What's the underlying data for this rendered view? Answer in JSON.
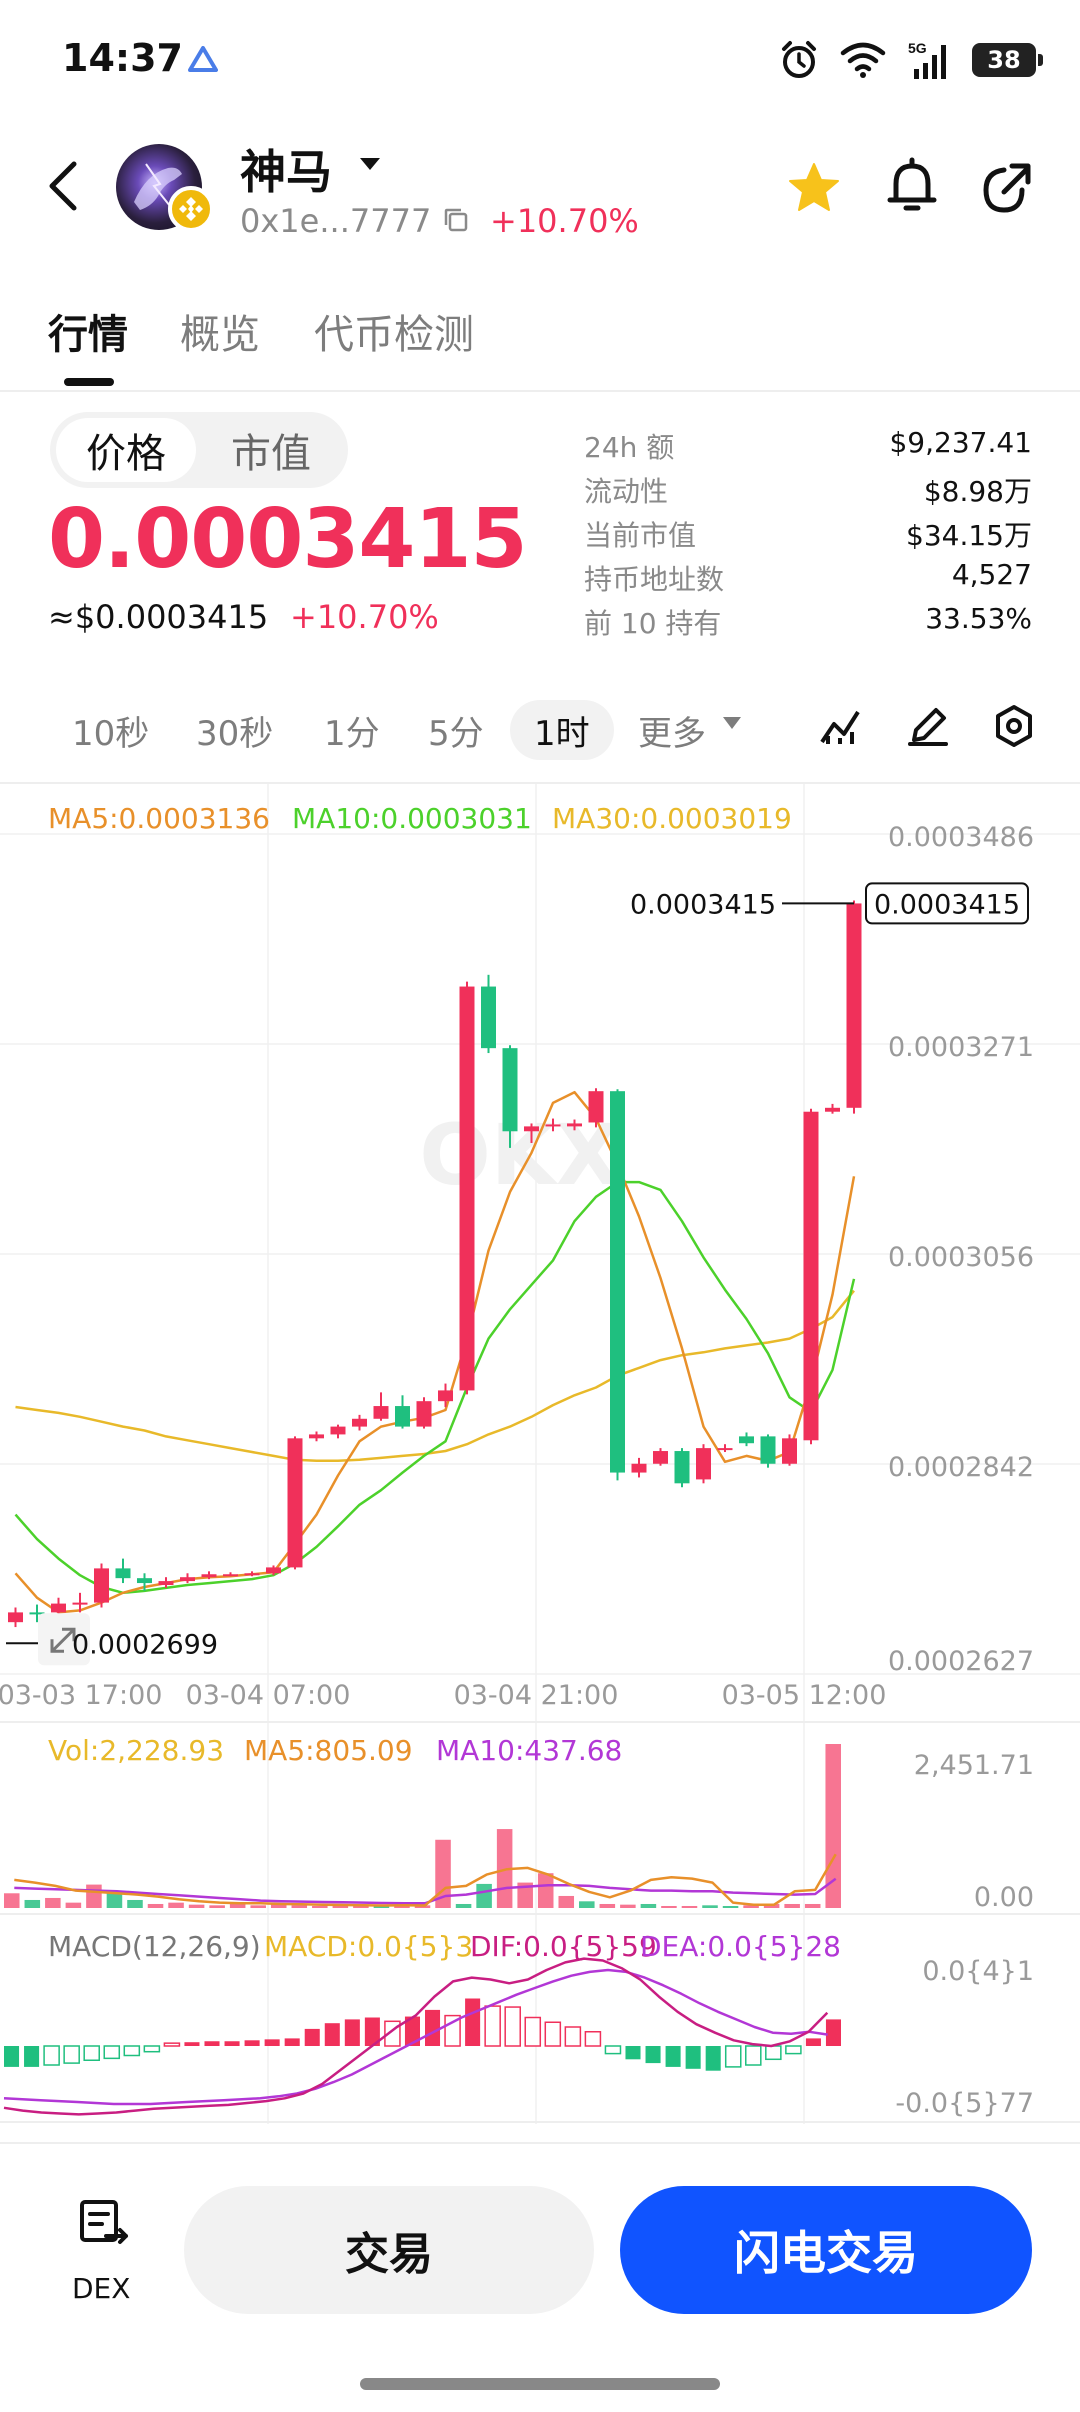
{
  "status_bar": {
    "time": "14:37",
    "battery": "38",
    "network": "5G"
  },
  "header": {
    "token_name": "神马",
    "address": "0x1e...7777",
    "change": "+10.70%"
  },
  "tabs": [
    "行情",
    "概览",
    "代币检测"
  ],
  "price_toggle": {
    "price": "价格",
    "market_cap": "市值"
  },
  "price": {
    "value": "0.0003415",
    "usd": "≈$0.0003415",
    "change": "+10.70%"
  },
  "stats": [
    {
      "label": "24h  额",
      "value": "$9,237.41"
    },
    {
      "label": "流动性",
      "value": "$8.98万"
    },
    {
      "label": "当前市值",
      "value": "$34.15万"
    },
    {
      "label": "持币地址数",
      "value": "4,527"
    },
    {
      "label": "前 10 持有",
      "value": "33.53%"
    }
  ],
  "intervals": [
    "10秒",
    "30秒",
    "1分",
    "5分",
    "1时",
    "更多"
  ],
  "chart_data": {
    "type": "candlestick",
    "indicators": {
      "ma": [
        {
          "name": "MA5",
          "label": "MA5:0.0003136",
          "color": "#e8902a"
        },
        {
          "name": "MA10",
          "label": "MA10:0.0003031",
          "color": "#4cd12b"
        },
        {
          "name": "MA30",
          "label": "MA30:0.0003019",
          "color": "#e8b92a"
        }
      ]
    },
    "y_ticks": [
      "0.0003486",
      "0.0003271",
      "0.0003056",
      "0.0002842",
      "0.0002627"
    ],
    "ylim": [
      0.0002627,
      0.0003486
    ],
    "x_ticks": [
      "03-03 17:00",
      "03-04 07:00",
      "03-04 21:00",
      "03-05 12:00"
    ],
    "current_price_label": "0.0003415",
    "current_price_tag": "0.0003415",
    "low_label": "0.0002699",
    "candles": [
      {
        "o": 0.000268,
        "c": 0.000269,
        "h": 0.0002695,
        "l": 0.0002675
      },
      {
        "o": 0.000269,
        "c": 0.0002688,
        "h": 0.0002698,
        "l": 0.000268
      },
      {
        "o": 0.000269,
        "c": 0.0002699,
        "h": 0.0002705,
        "l": 0.0002685
      },
      {
        "o": 0.0002699,
        "c": 0.00027,
        "h": 0.000271,
        "l": 0.000269
      },
      {
        "o": 0.00027,
        "c": 0.0002735,
        "h": 0.000274,
        "l": 0.0002695
      },
      {
        "o": 0.0002735,
        "c": 0.0002725,
        "h": 0.0002745,
        "l": 0.000272
      },
      {
        "o": 0.0002725,
        "c": 0.000272,
        "h": 0.000273,
        "l": 0.0002712
      },
      {
        "o": 0.0002718,
        "c": 0.0002722,
        "h": 0.0002726,
        "l": 0.0002715
      },
      {
        "o": 0.0002722,
        "c": 0.0002726,
        "h": 0.000273,
        "l": 0.000272
      },
      {
        "o": 0.0002726,
        "c": 0.0002729,
        "h": 0.0002732,
        "l": 0.0002724
      },
      {
        "o": 0.0002729,
        "c": 0.0002729,
        "h": 0.0002731,
        "l": 0.0002727
      },
      {
        "o": 0.0002729,
        "c": 0.000273,
        "h": 0.0002732,
        "l": 0.0002727
      },
      {
        "o": 0.000273,
        "c": 0.0002736,
        "h": 0.0002738,
        "l": 0.0002728
      },
      {
        "o": 0.0002736,
        "c": 0.0002868,
        "h": 0.000287,
        "l": 0.0002734
      },
      {
        "o": 0.0002868,
        "c": 0.0002872,
        "h": 0.0002875,
        "l": 0.0002865
      },
      {
        "o": 0.0002872,
        "c": 0.000288,
        "h": 0.0002882,
        "l": 0.0002868
      },
      {
        "o": 0.000288,
        "c": 0.0002888,
        "h": 0.0002892,
        "l": 0.0002876
      },
      {
        "o": 0.0002888,
        "c": 0.0002901,
        "h": 0.0002915,
        "l": 0.0002886
      },
      {
        "o": 0.0002901,
        "c": 0.000288,
        "h": 0.0002912,
        "l": 0.0002878
      },
      {
        "o": 0.000288,
        "c": 0.0002906,
        "h": 0.000291,
        "l": 0.0002878
      },
      {
        "o": 0.0002906,
        "c": 0.0002917,
        "h": 0.0002924,
        "l": 0.00029
      },
      {
        "o": 0.0002917,
        "c": 0.000333,
        "h": 0.0003335,
        "l": 0.0002913
      },
      {
        "o": 0.000333,
        "c": 0.0003267,
        "h": 0.0003342,
        "l": 0.0003262
      },
      {
        "o": 0.0003267,
        "c": 0.0003182,
        "h": 0.000327,
        "l": 0.0003165
      },
      {
        "o": 0.0003182,
        "c": 0.0003187,
        "h": 0.000319,
        "l": 0.000317
      },
      {
        "o": 0.0003187,
        "c": 0.0003189,
        "h": 0.0003195,
        "l": 0.0003182
      },
      {
        "o": 0.0003187,
        "c": 0.000319,
        "h": 0.0003194,
        "l": 0.0003183
      },
      {
        "o": 0.0003191,
        "c": 0.0003223,
        "h": 0.0003226,
        "l": 0.0003186
      },
      {
        "o": 0.0003223,
        "c": 0.0002833,
        "h": 0.0003225,
        "l": 0.0002825
      },
      {
        "o": 0.0002833,
        "c": 0.0002842,
        "h": 0.0002848,
        "l": 0.0002828
      },
      {
        "o": 0.0002842,
        "c": 0.0002855,
        "h": 0.0002858,
        "l": 0.000284
      },
      {
        "o": 0.0002855,
        "c": 0.0002822,
        "h": 0.0002858,
        "l": 0.0002818
      },
      {
        "o": 0.0002826,
        "c": 0.0002858,
        "h": 0.0002862,
        "l": 0.0002822
      },
      {
        "o": 0.0002858,
        "c": 0.0002858,
        "h": 0.0002862,
        "l": 0.0002854
      },
      {
        "o": 0.000287,
        "c": 0.0002863,
        "h": 0.0002874,
        "l": 0.000286
      },
      {
        "o": 0.000287,
        "c": 0.0002842,
        "h": 0.0002872,
        "l": 0.0002838
      },
      {
        "o": 0.0002842,
        "c": 0.0002868,
        "h": 0.0002872,
        "l": 0.000284
      },
      {
        "o": 0.0002866,
        "c": 0.0003202,
        "h": 0.0003205,
        "l": 0.0002862
      },
      {
        "o": 0.0003202,
        "c": 0.0003206,
        "h": 0.000321,
        "l": 0.00032
      },
      {
        "o": 0.0003206,
        "c": 0.0003415,
        "h": 0.0003418,
        "l": 0.00032
      }
    ],
    "ma5_line": [
      0.000273,
      0.0002705,
      0.000269,
      0.0002692,
      0.00027,
      0.000271,
      0.0002716,
      0.000272,
      0.0002724,
      0.0002726,
      0.0002727,
      0.0002729,
      0.0002731,
      0.000276,
      0.000279,
      0.000283,
      0.0002865,
      0.000288,
      0.0002885,
      0.0002889,
      0.0002897,
      0.000297,
      0.000306,
      0.000312,
      0.000316,
      0.0003211,
      0.0003222,
      0.0003195,
      0.0003148,
      0.0003095,
      0.0003032,
      0.000296,
      0.000288,
      0.0002844,
      0.000285,
      0.0002845,
      0.0002854,
      0.0002925,
      0.0003015,
      0.0003136
    ],
    "ma10_line": [
      0.000279,
      0.0002765,
      0.0002745,
      0.0002728,
      0.0002716,
      0.000271,
      0.0002712,
      0.0002715,
      0.0002718,
      0.000272,
      0.0002722,
      0.0002724,
      0.0002728,
      0.000274,
      0.0002757,
      0.0002778,
      0.00028,
      0.0002815,
      0.0002833,
      0.000285,
      0.0002865,
      0.000292,
      0.000297,
      0.0003,
      0.0003025,
      0.000305,
      0.000309,
      0.0003115,
      0.000313,
      0.000313,
      0.0003122,
      0.000309,
      0.0003053,
      0.000302,
      0.000299,
      0.0002955,
      0.000291,
      0.0002895,
      0.0002938,
      0.0003031
    ],
    "ma30_line": [
      0.00029,
      0.0002897,
      0.0002894,
      0.000289,
      0.0002885,
      0.000288,
      0.0002876,
      0.000287,
      0.0002866,
      0.0002862,
      0.0002858,
      0.0002854,
      0.000285,
      0.0002846,
      0.0002845,
      0.0002845,
      0.0002846,
      0.0002848,
      0.000285,
      0.0002852,
      0.0002855,
      0.0002862,
      0.0002872,
      0.000288,
      0.000289,
      0.0002902,
      0.0002912,
      0.000292,
      0.0002932,
      0.000294,
      0.0002948,
      0.0002953,
      0.0002956,
      0.000296,
      0.0002963,
      0.0002966,
      0.000297,
      0.000298,
      0.0002992,
      0.0003019
    ],
    "volume": {
      "labels": {
        "vol": "Vol:2,228.93",
        "ma5": "MA5:805.09",
        "ma10": "MA10:437.68"
      },
      "y_ticks": [
        "2,451.71",
        "0.00"
      ],
      "ylim": [
        0,
        2451.71
      ],
      "values": [
        220,
        120,
        150,
        80,
        350,
        260,
        120,
        60,
        80,
        50,
        40,
        60,
        40,
        60,
        40,
        30,
        40,
        30,
        30,
        40,
        40,
        1020,
        60,
        360,
        1180,
        380,
        520,
        180,
        100,
        60,
        50,
        60,
        30,
        30,
        40,
        30,
        40,
        60,
        60,
        60,
        2451.71
      ],
      "ma5_line": [
        420,
        380,
        330,
        260,
        240,
        220,
        200,
        170,
        130,
        100,
        80,
        70,
        70,
        60,
        55,
        50,
        45,
        40,
        38,
        40,
        38,
        300,
        330,
        500,
        580,
        600,
        500,
        360,
        240,
        160,
        260,
        420,
        460,
        440,
        380,
        80,
        50,
        50,
        250,
        270,
        805
      ],
      "ma10_line": [
        300,
        290,
        280,
        270,
        260,
        250,
        230,
        210,
        190,
        170,
        150,
        130,
        110,
        100,
        95,
        90,
        85,
        80,
        75,
        70,
        70,
        180,
        200,
        250,
        300,
        320,
        340,
        340,
        330,
        300,
        280,
        260,
        260,
        250,
        250,
        230,
        220,
        210,
        200,
        210,
        437
      ]
    },
    "macd": {
      "labels": {
        "macd": "MACD(12,26,9)",
        "hist": "MACD:0.0{5}3",
        "dif": "DIF:0.0{5}59",
        "dea": "DEA:0.0{5}28"
      },
      "y_ticks": [
        "0.0{4}1",
        "-0.0{5}77"
      ],
      "ylim": [
        -7.7e-06,
        1e-05
      ],
      "hist": [
        -2.2,
        -2.2,
        -2.0,
        -1.8,
        -1.5,
        -1.3,
        -1.0,
        -0.6,
        0.3,
        0.4,
        0.5,
        0.5,
        0.6,
        0.7,
        0.8,
        1.8,
        2.4,
        2.8,
        3.0,
        2.6,
        3.1,
        3.8,
        3.2,
        5.0,
        4.2,
        4.1,
        3.0,
        2.5,
        2.0,
        1.5,
        -0.8,
        -1.4,
        -1.8,
        -2.2,
        -2.4,
        -2.6,
        -2.2,
        -2.0,
        -1.4,
        -0.8,
        0.8,
        2.8
      ],
      "dif": [
        -6.5,
        -6.8,
        -7.0,
        -7.1,
        -7.2,
        -7.1,
        -7.0,
        -6.8,
        -6.6,
        -6.5,
        -6.4,
        -6.3,
        -6.2,
        -6.0,
        -5.8,
        -5.5,
        -5.0,
        -4.0,
        -2.5,
        -1.0,
        0.5,
        2.0,
        3.2,
        5.2,
        6.8,
        7.2,
        7.0,
        6.6,
        7.0,
        8.0,
        8.8,
        9.2,
        9.0,
        8.2,
        7.0,
        5.2,
        3.6,
        2.3,
        1.4,
        0.6,
        0.2,
        0.0,
        0.5,
        1.5,
        3.5
      ],
      "dea": [
        -5.5,
        -5.6,
        -5.7,
        -5.8,
        -5.9,
        -6.0,
        -6.1,
        -6.1,
        -6.1,
        -6.0,
        -5.9,
        -5.8,
        -5.7,
        -5.6,
        -5.5,
        -5.3,
        -5.0,
        -4.5,
        -3.8,
        -3.0,
        -2.0,
        -1.0,
        0.0,
        1.0,
        2.0,
        3.0,
        3.8,
        4.6,
        5.4,
        6.1,
        6.8,
        7.4,
        7.8,
        8.0,
        7.8,
        7.2,
        6.4,
        5.5,
        4.5,
        3.6,
        2.8,
        2.0,
        1.4,
        1.3,
        1.5,
        1.2
      ]
    }
  },
  "bottom_bar": {
    "dex_label": "DEX",
    "trade": "交易",
    "flash_trade": "闪电交易"
  },
  "colors": {
    "up": "#f0305a",
    "down": "#1fbf7f",
    "accent": "#1054ff",
    "star": "#f7c21b"
  }
}
